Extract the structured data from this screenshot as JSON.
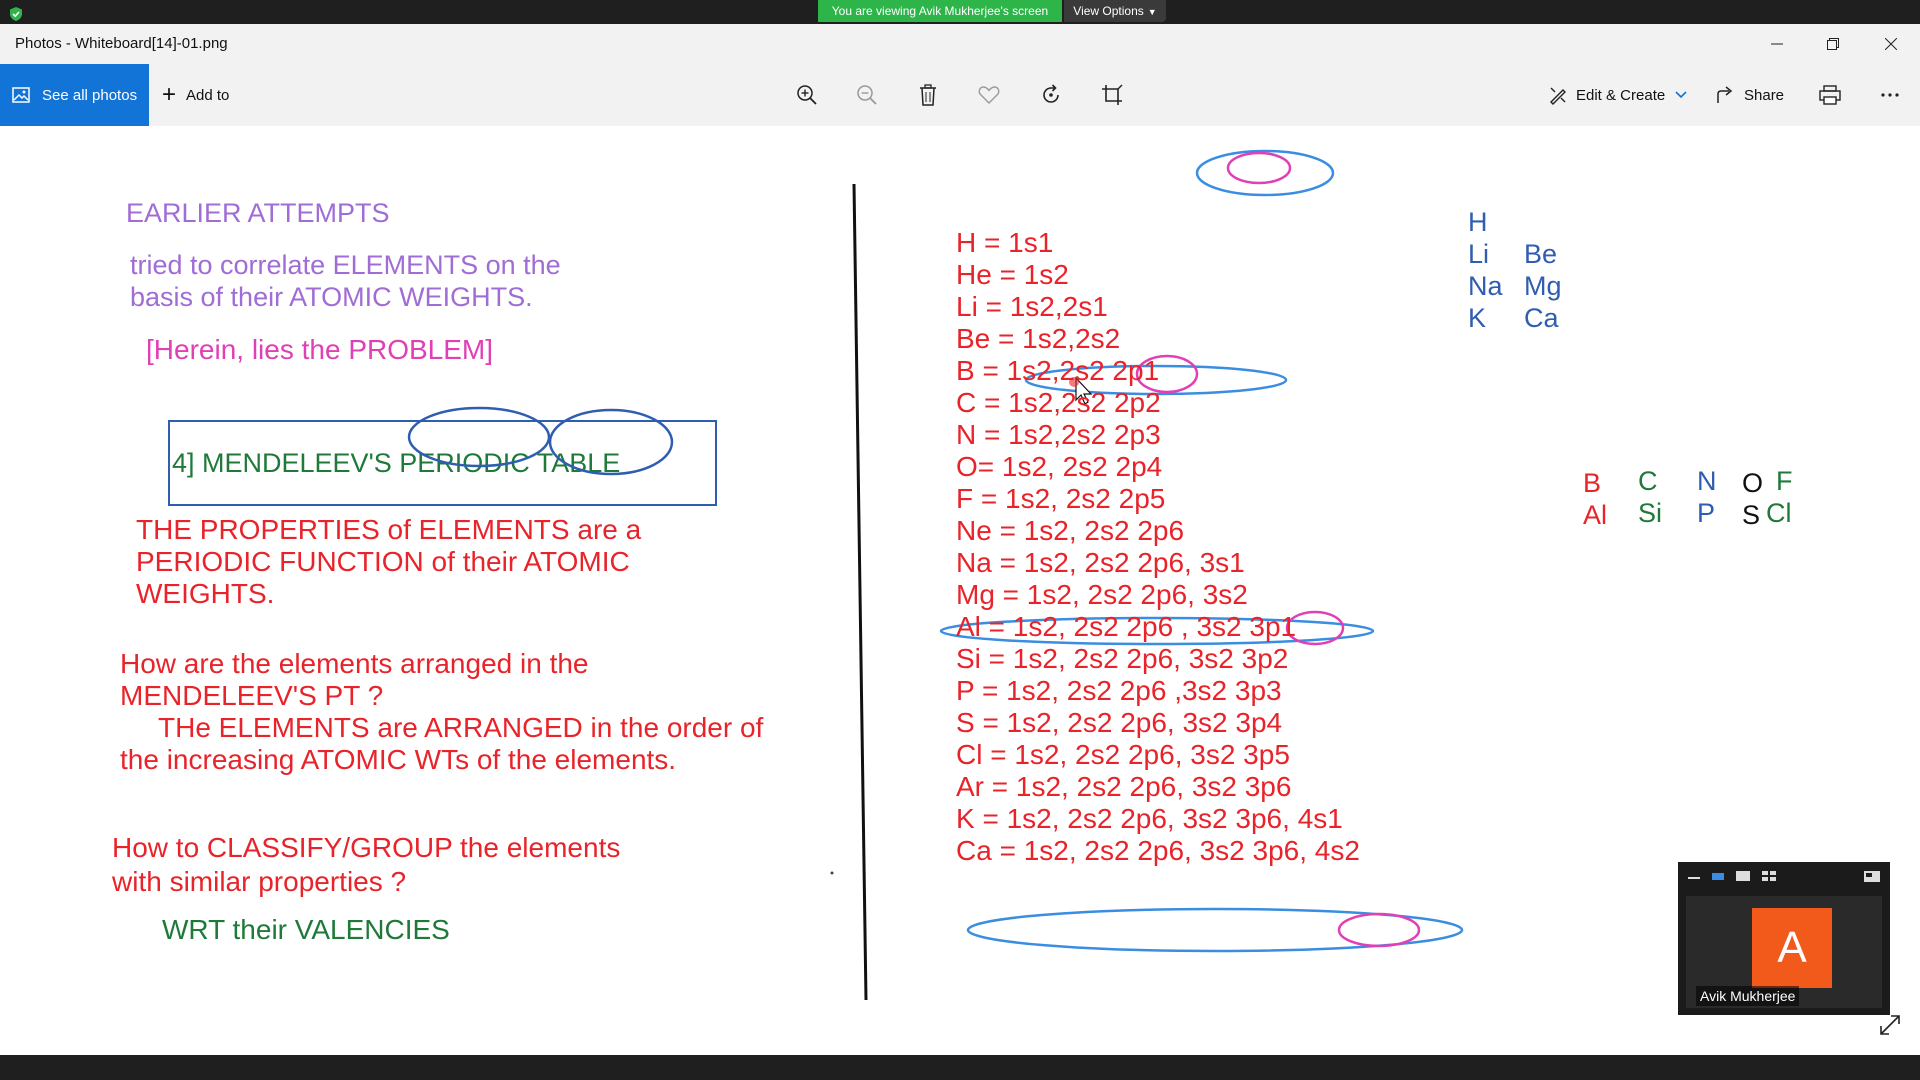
{
  "share": {
    "banner": "You are viewing Avik Mukherjee's screen",
    "view_options": "View Options"
  },
  "window": {
    "title": "Photos - Whiteboard[14]-01.png"
  },
  "toolbar": {
    "see_all": "See all photos",
    "add_to": "Add to",
    "edit_create": "Edit & Create",
    "share": "Share",
    "icons": [
      "zoom-in-icon",
      "zoom-out-icon",
      "delete-icon",
      "favorite-icon",
      "rotate-icon",
      "crop-icon",
      "print-icon",
      "more-icon"
    ]
  },
  "whiteboard": {
    "left": {
      "heading": "EARLIER ATTEMPTS",
      "line1": "tried to correlate ELEMENTS on the",
      "line2": "basis of their ATOMIC WEIGHTS.",
      "problem": "[Herein, lies the PROBLEM]",
      "box_title": "4] MENDELEEV'S PERIODIC TABLE",
      "law1": "THE PROPERTIES of ELEMENTS are a",
      "law2": "PERIODIC FUNCTION of their ATOMIC",
      "law3": "WEIGHTS.",
      "q1": "How are the elements arranged in the",
      "q2": "MENDELEEV'S PT ?",
      "a1": "THe ELEMENTS are ARRANGED in the order of",
      "a2": "the increasing ATOMIC WTs  of the elements.",
      "q3": "How to CLASSIFY/GROUP the elements",
      "q4": "with similar properties ?",
      "a3": "WRT their VALENCIES"
    },
    "configs": [
      "H = 1s1",
      "He = 1s2",
      "Li = 1s2,2s1",
      "Be = 1s2,2s2",
      "B = 1s2,2s2 2p1",
      "C = 1s2,2s2 2p2",
      "N = 1s2,2s2 2p3",
      "O= 1s2, 2s2 2p4",
      "F = 1s2, 2s2 2p5",
      "Ne = 1s2, 2s2 2p6",
      "Na = 1s2, 2s2 2p6, 3s1",
      "Mg = 1s2, 2s2 2p6, 3s2",
      "Al = 1s2, 2s2 2p6 , 3s2 3p1",
      "Si = 1s2, 2s2 2p6, 3s2 3p2",
      "P = 1s2, 2s2 2p6 ,3s2 3p3",
      "S = 1s2, 2s2 2p6, 3s2 3p4",
      "Cl = 1s2, 2s2 2p6, 3s2 3p5",
      "Ar = 1s2, 2s2 2p6, 3s2 3p6",
      "K = 1s2, 2s2 2p6, 3s2 3p6, 4s1",
      "Ca = 1s2, 2s2 2p6, 3s2 3p6, 4s2"
    ],
    "group1": [
      "H",
      "Li",
      "Na",
      "K"
    ],
    "group2": [
      "Be",
      "Mg",
      "Ca"
    ],
    "p_block": {
      "b": "B",
      "al": "Al",
      "c": "C",
      "si": "Si",
      "n": "N",
      "p": "P",
      "o": "O",
      "s": "S",
      "f": "F",
      "cl": "Cl"
    }
  },
  "video": {
    "initial": "A",
    "name": "Avik Mukherjee"
  },
  "colors": {
    "accent": "#1174d6",
    "share_green": "#2db54a",
    "avatar": "#f25a1c"
  }
}
